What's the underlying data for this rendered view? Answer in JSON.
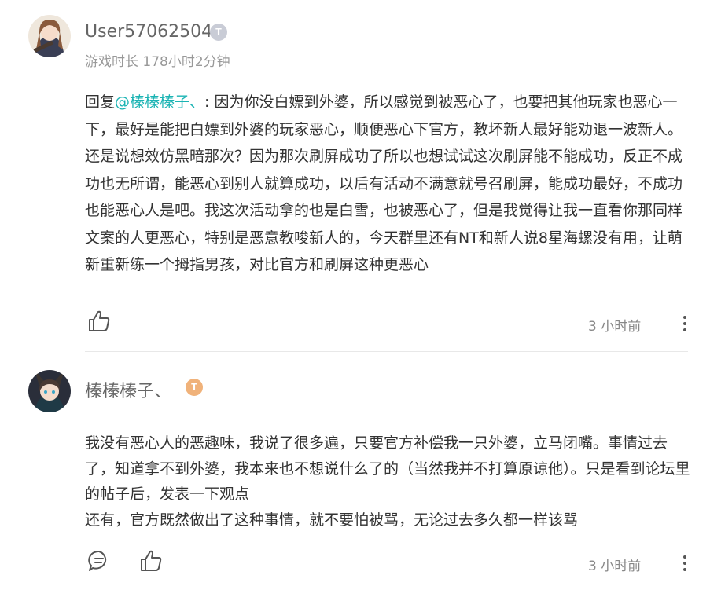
{
  "comments": [
    {
      "username": "User57062504",
      "level_badge": "T",
      "playtime": "游戏时长 178小时2分钟",
      "reply_prefix": "回复",
      "mention": "@榛榛榛子、",
      "reply_separator": ":",
      "text": " 因为你没白嫖到外婆，所以感觉到被恶心了，也要把其他玩家也恶心一下，最好是能把白嫖到外婆的玩家恶心，顺便恶心下官方，教坏新人最好能劝退一波新人。还是说想效仿黑暗那次？因为那次刷屏成功了所以也想试试这次刷屏能不能成功，反正不成功也无所谓，能恶心到别人就算成功，以后有活动不满意就号召刷屏，能成功最好，不成功也能恶心人是吧。我这次活动拿的也是白雪，也被恶心了，但是我觉得让我一直看你那同样文案的人更恶心，特别是恶意教唆新人的，今天群里还有NT和新人说8星海螺没有用，让萌新重新练一个拇指男孩，对比官方和刷屏这种更恶心",
      "time": "3 小时前",
      "icons": [
        "like-icon",
        "more-icon"
      ]
    },
    {
      "username": "榛榛榛子、",
      "level_badge": "T",
      "paragraphs": [
        "我没有恶心人的恶趣味，我说了很多遍，只要官方补偿我一只外婆，立马闭嘴。事情过去了，知道拿不到外婆，我本来也不想说什么了的（当然我并不打算原谅他）。只是看到论坛里的帖子后，发表一下观点",
        "还有，官方既然做出了这种事情，就不要怕被骂，无论过去多久都一样该骂"
      ],
      "time": "3 小时前",
      "icons": [
        "comment-icon",
        "like-icon",
        "more-icon"
      ]
    }
  ],
  "colors": {
    "mention": "#1ab3b3",
    "badge_gray": "#c9ccd6",
    "badge_orange": "#f0b27a"
  }
}
